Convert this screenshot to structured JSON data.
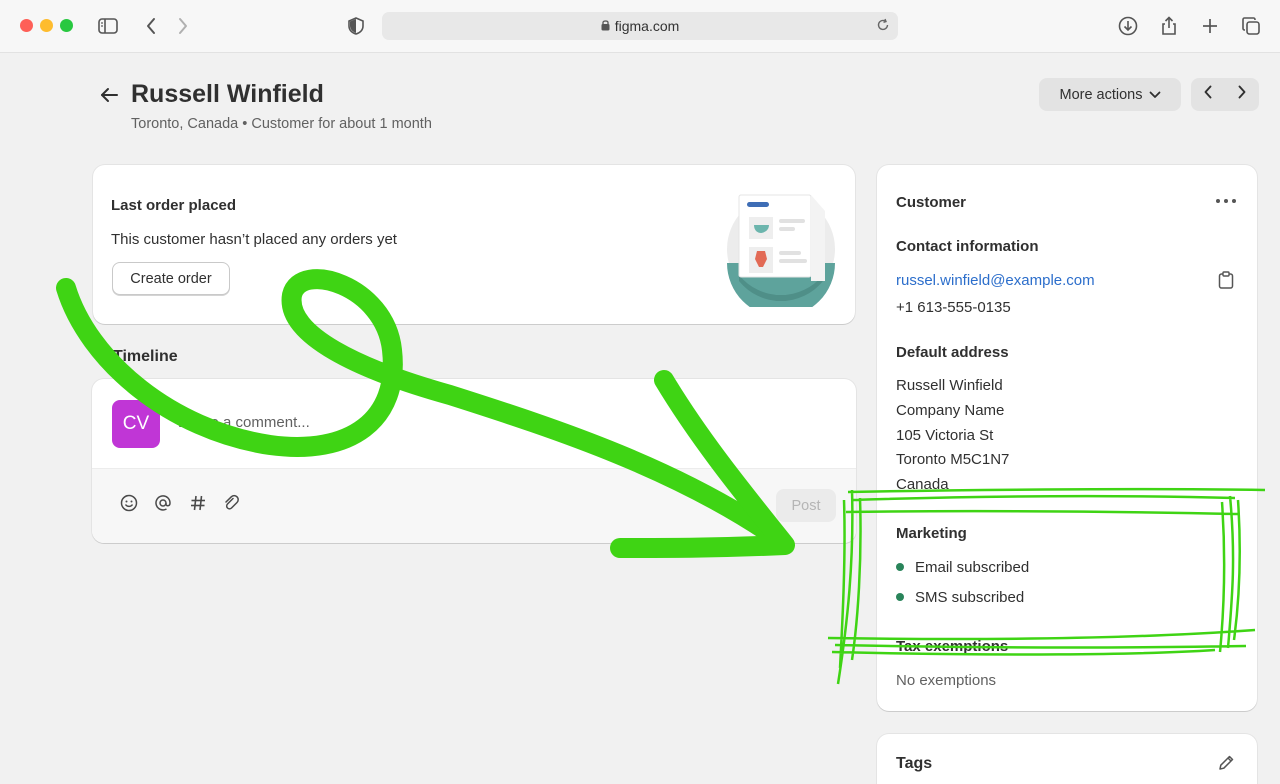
{
  "browser": {
    "url": "figma.com"
  },
  "header": {
    "title": "Russell Winfield",
    "subtitle": "Toronto, Canada • Customer for about 1 month",
    "more_actions_label": "More actions"
  },
  "last_order": {
    "heading": "Last order placed",
    "message": "This customer hasn’t placed any orders yet",
    "create_button": "Create order"
  },
  "timeline": {
    "heading": "Timeline",
    "avatar_initials": "CV",
    "comment_placeholder": "Leave a comment...",
    "post_button": "Post"
  },
  "customer": {
    "heading": "Customer",
    "contact_heading": "Contact information",
    "email": "russel.winfield@example.com",
    "phone": "+1 613-555-0135",
    "address_heading": "Default address",
    "address_lines": [
      "Russell Winfield",
      "Company Name",
      "105 Victoria St",
      "Toronto M5C1N7",
      "Canada"
    ],
    "marketing_heading": "Marketing",
    "marketing_items": [
      "Email subscribed",
      "SMS subscribed"
    ],
    "tax_heading": "Tax exemptions",
    "tax_value": "No exemptions"
  },
  "tags": {
    "heading": "Tags"
  },
  "colors": {
    "annotation": "#3fd414",
    "avatar": "#c036d6",
    "link": "#2c6ecb",
    "subscribed_dot": "#29845a"
  }
}
